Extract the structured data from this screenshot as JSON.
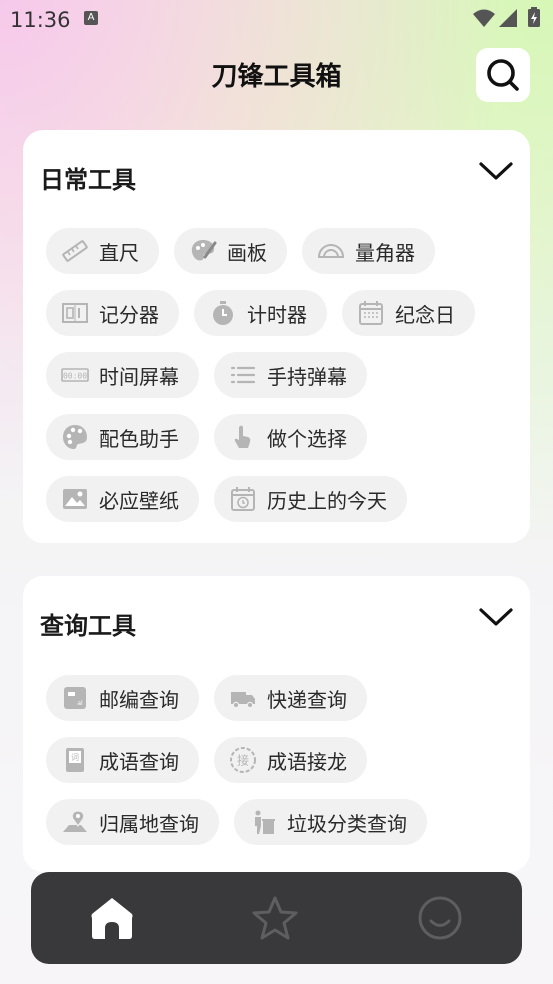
{
  "status_bar": {
    "time": "11:36",
    "notification_icon": "A"
  },
  "header": {
    "title": "刀锋工具箱",
    "search_icon": "search-icon"
  },
  "sections": [
    {
      "title": "日常工具",
      "expanded": true,
      "tools": [
        {
          "label": "直尺",
          "icon": "ruler-icon"
        },
        {
          "label": "画板",
          "icon": "palette-brush-icon"
        },
        {
          "label": "量角器",
          "icon": "protractor-icon"
        },
        {
          "label": "记分器",
          "icon": "scoreboard-icon"
        },
        {
          "label": "计时器",
          "icon": "stopwatch-icon"
        },
        {
          "label": "纪念日",
          "icon": "calendar-icon"
        },
        {
          "label": "时间屏幕",
          "icon": "digital-clock-icon"
        },
        {
          "label": "手持弹幕",
          "icon": "list-lines-icon"
        },
        {
          "label": "配色助手",
          "icon": "palette-icon"
        },
        {
          "label": "做个选择",
          "icon": "pointing-hand-icon"
        },
        {
          "label": "必应壁纸",
          "icon": "image-icon"
        },
        {
          "label": "历史上的今天",
          "icon": "history-calendar-icon"
        }
      ]
    },
    {
      "title": "查询工具",
      "expanded": true,
      "tools": [
        {
          "label": "邮编查询",
          "icon": "postcode-icon"
        },
        {
          "label": "快递查询",
          "icon": "delivery-truck-icon"
        },
        {
          "label": "成语查询",
          "icon": "dictionary-icon"
        },
        {
          "label": "成语接龙",
          "icon": "idiom-chain-icon"
        },
        {
          "label": "归属地查询",
          "icon": "location-map-icon"
        },
        {
          "label": "垃圾分类查询",
          "icon": "trash-sort-icon"
        }
      ]
    }
  ],
  "bottom_nav": [
    {
      "name": "home",
      "icon": "home-icon",
      "active": true
    },
    {
      "name": "favorites",
      "icon": "star-icon",
      "active": false
    },
    {
      "name": "profile",
      "icon": "smiley-icon",
      "active": false
    }
  ],
  "colors": {
    "card": "#ffffff",
    "chip": "#f1f1f1",
    "icon_gray": "#b5b5b5",
    "nav_bg": "#39393b",
    "nav_active": "#ffffff",
    "nav_inactive": "#5e5e60"
  }
}
